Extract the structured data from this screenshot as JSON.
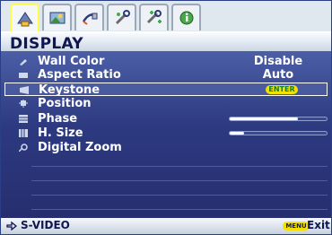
{
  "tabs": [
    {
      "icon": "display-tab-icon",
      "active": true
    },
    {
      "icon": "picture-tab-icon",
      "active": false
    },
    {
      "icon": "source-tab-icon",
      "active": false
    },
    {
      "icon": "system-setup-tab-icon",
      "active": false
    },
    {
      "icon": "advanced-setup-tab-icon",
      "active": false
    },
    {
      "icon": "information-tab-icon",
      "active": false
    }
  ],
  "title": "DISPLAY",
  "items": [
    {
      "label": "Wall Color",
      "value": "Disable"
    },
    {
      "label": "Aspect Ratio",
      "value": "Auto"
    },
    {
      "label": "Keystone",
      "value": "ENTER"
    },
    {
      "label": "Position",
      "value": ""
    },
    {
      "label": "Phase",
      "value": "",
      "level": 0.7
    },
    {
      "label": "H. Size",
      "value": "",
      "level": 0.15
    },
    {
      "label": "Digital Zoom",
      "value": ""
    }
  ],
  "footer": {
    "source": "S-VIDEO",
    "menu_key": "MENU",
    "exit_label": "Exit"
  },
  "colors": {
    "panel": "#2d3a80",
    "enter_badge": "#f2e100",
    "active_tab_border": "#fffb4a",
    "title_text": "#101650"
  }
}
